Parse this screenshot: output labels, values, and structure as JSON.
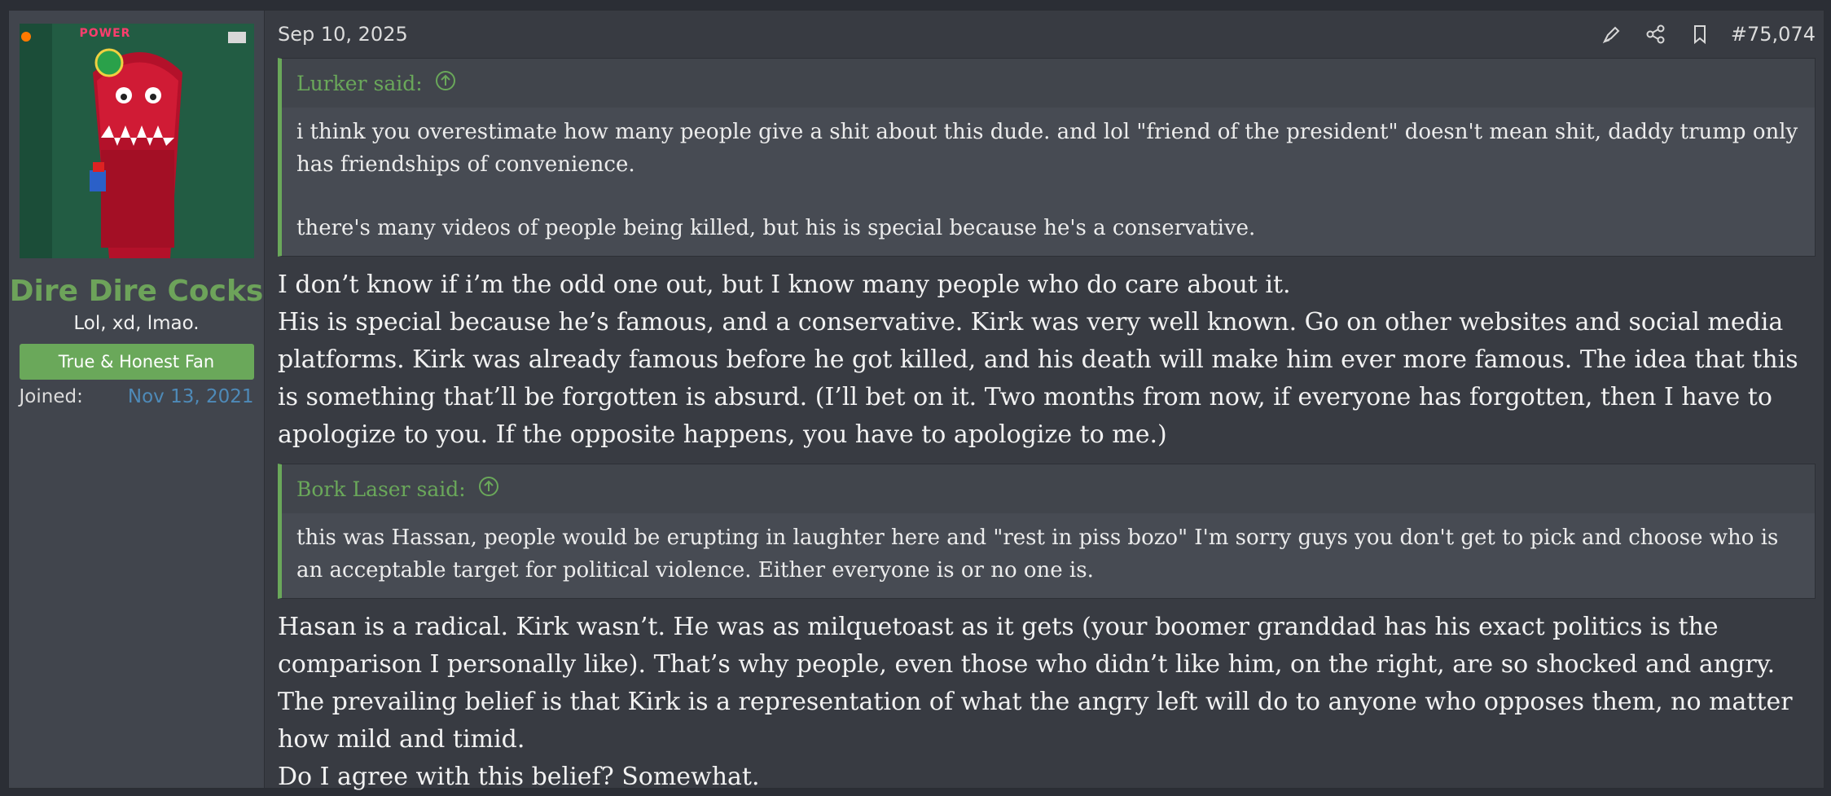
{
  "user": {
    "name": "Dire Dire Cocks",
    "title": "Lol, xd, lmao.",
    "banner": "True & Honest Fan",
    "joined_label": "Joined:",
    "joined_date": "Nov 13, 2021",
    "avatar_hud": "POWER"
  },
  "post": {
    "date": "Sep 10, 2025",
    "number": "#75,074",
    "icons": [
      "highlight-icon",
      "share-icon",
      "bookmark-icon"
    ],
    "quote1": {
      "author": "Lurker said:",
      "paragraphs": [
        "i think you overestimate how many people give a shit about this dude. and lol \"friend of the president\" doesn't mean shit, daddy trump only has friendships of convenience.",
        "there's many videos of people being killed, but his is special because he's a conservative."
      ]
    },
    "reply1": [
      "I don’t know if i’m the odd one out, but I know many people who do care about it.",
      "His is special because he’s famous, and a conservative. Kirk was very well known. Go on other websites and social media platforms. Kirk was already famous before he got killed, and his death will make him ever more famous. The idea that this is something that’ll be forgotten is absurd. (I’ll bet on it. Two months from now, if everyone has forgotten, then I have to apologize to you. If the opposite happens, you have to apologize to me.)"
    ],
    "quote2": {
      "author": "Bork Laser said:",
      "paragraphs": [
        "this was Hassan, people would be erupting in laughter here and \"rest in piss bozo\" I'm sorry guys you don't get to pick and choose who is an acceptable target for political violence. Either everyone is or no one is."
      ]
    },
    "reply2": [
      "Hasan is a radical. Kirk wasn’t. He was as milquetoast as it gets (your boomer granddad has his exact politics is the comparison I personally like). That’s why people, even those who didn’t like him, on the right, are so shocked and angry. The prevailing belief is that Kirk is a representation of what the angry left will do to anyone who opposes them, no matter how mild and timid.",
      "Do I agree with this belief? Somewhat."
    ]
  },
  "colors": {
    "accent_green": "#6aa85a",
    "link_blue": "#4e8ab8",
    "background": "#383b42"
  }
}
